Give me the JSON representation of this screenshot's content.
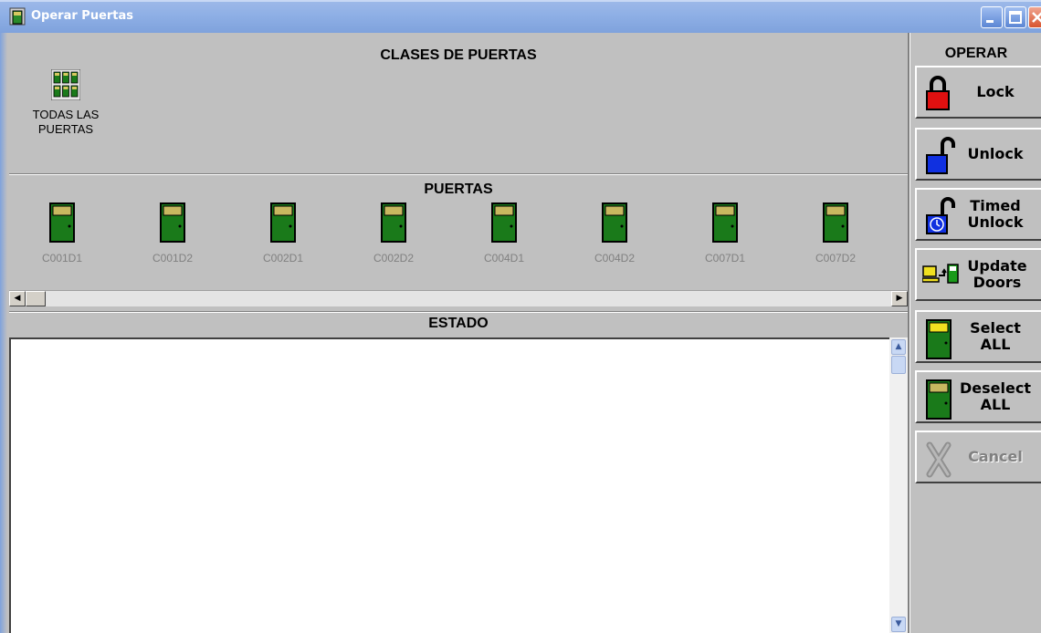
{
  "window": {
    "title": "Operar Puertas",
    "icon": "door-app-icon"
  },
  "sections": {
    "classes_header": "CLASES DE PUERTAS",
    "doors_header": "PUERTAS",
    "status_header": "ESTADO",
    "operate_header": "OPERAR"
  },
  "door_classes": [
    {
      "label": "TODAS LAS\nPUERTAS",
      "icon": "door-group-icon"
    }
  ],
  "doors": [
    {
      "label": "C001D1"
    },
    {
      "label": "C001D2"
    },
    {
      "label": "C002D1"
    },
    {
      "label": "C002D2"
    },
    {
      "label": "C004D1"
    },
    {
      "label": "C004D2"
    },
    {
      "label": "C007D1"
    },
    {
      "label": "C007D2"
    }
  ],
  "status": {
    "text": ""
  },
  "operate_buttons": {
    "lock": "Lock",
    "unlock": "Unlock",
    "timed_unlock": "Timed\nUnlock",
    "update_doors": "Update\nDoors",
    "select_all": "Select\nALL",
    "deselect_all": "Deselect\nALL",
    "cancel": "Cancel"
  },
  "colors": {
    "door_green": "#1a7a1a",
    "lock_red": "#e01010",
    "unlock_blue": "#1030e0",
    "door_disabled_label": "#808080"
  }
}
